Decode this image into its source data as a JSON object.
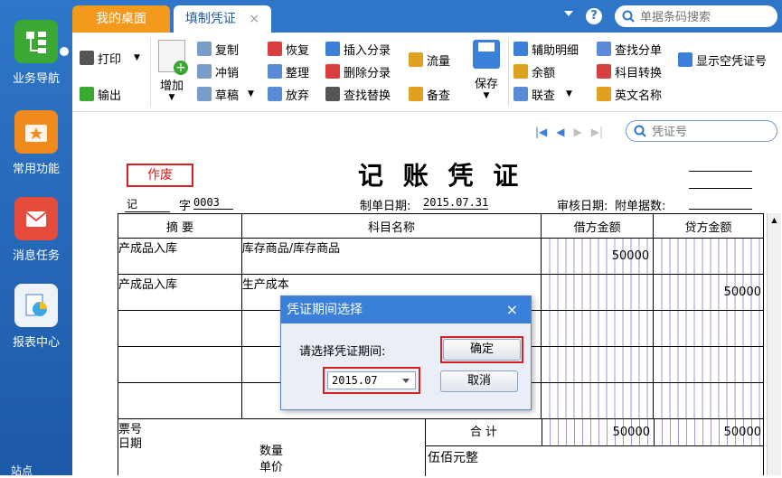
{
  "nav": [
    {
      "label": "业务导航",
      "icon": "business-nav-icon"
    },
    {
      "label": "常用功能",
      "icon": "star-icon"
    },
    {
      "label": "消息任务",
      "icon": "mail-icon"
    },
    {
      "label": "报表中心",
      "icon": "report-icon"
    }
  ],
  "tabs": {
    "desktop": "我的桌面",
    "voucher": "填制凭证",
    "close": "×"
  },
  "search": {
    "placeholder": "单据条码搜索"
  },
  "toolbar": {
    "print": "打印",
    "export": "输出",
    "add": "增加",
    "copy": "复制",
    "reverse": "冲销",
    "draft": "草稿",
    "restore": "恢复",
    "organize": "整理",
    "abandon": "放弃",
    "insert_entry": "插入分录",
    "delete_entry": "删除分录",
    "find_replace": "查找替换",
    "flow": "流量",
    "remark": "备查",
    "save": "保存",
    "aux_detail": "辅助明细",
    "balance": "余额",
    "linked_query": "联查",
    "find_entry": "查找分单",
    "subject_convert": "科目转换",
    "english_name": "英文名称",
    "show_empty": "显示空凭证号"
  },
  "voucher_search": {
    "placeholder": "凭证号"
  },
  "voucher": {
    "void_stamp": "作废",
    "title": "记 账 凭 证",
    "type": "记",
    "zi": "字",
    "number": "0003",
    "date_label": "制单日期:",
    "date": "2015.07.31",
    "audit_label": "审核日期:",
    "attach_label": "附单据数:",
    "headers": {
      "summary": "摘 要",
      "subject": "科目名称",
      "debit": "借方金额",
      "credit": "贷方金额"
    },
    "rows": [
      {
        "summary": "产成品入库",
        "subject": "库存商品/库存商品",
        "debit": "50000",
        "credit": ""
      },
      {
        "summary": "产成品入库",
        "subject": "生产成本",
        "debit": "",
        "credit": "50000"
      }
    ],
    "footer": {
      "ticket": "票号",
      "date": "日期",
      "qty": "数量",
      "unit_price": "单价",
      "total_label": "合 计",
      "total_debit": "50000",
      "total_credit": "50000",
      "amount_words": "伍佰元整"
    }
  },
  "dialog": {
    "title": "凭证期间选择",
    "close": "×",
    "prompt": "请选择凭证期间:",
    "period": "2015.07",
    "ok": "确定",
    "cancel": "取消"
  },
  "bottom_nav": {
    "label": "站点"
  }
}
